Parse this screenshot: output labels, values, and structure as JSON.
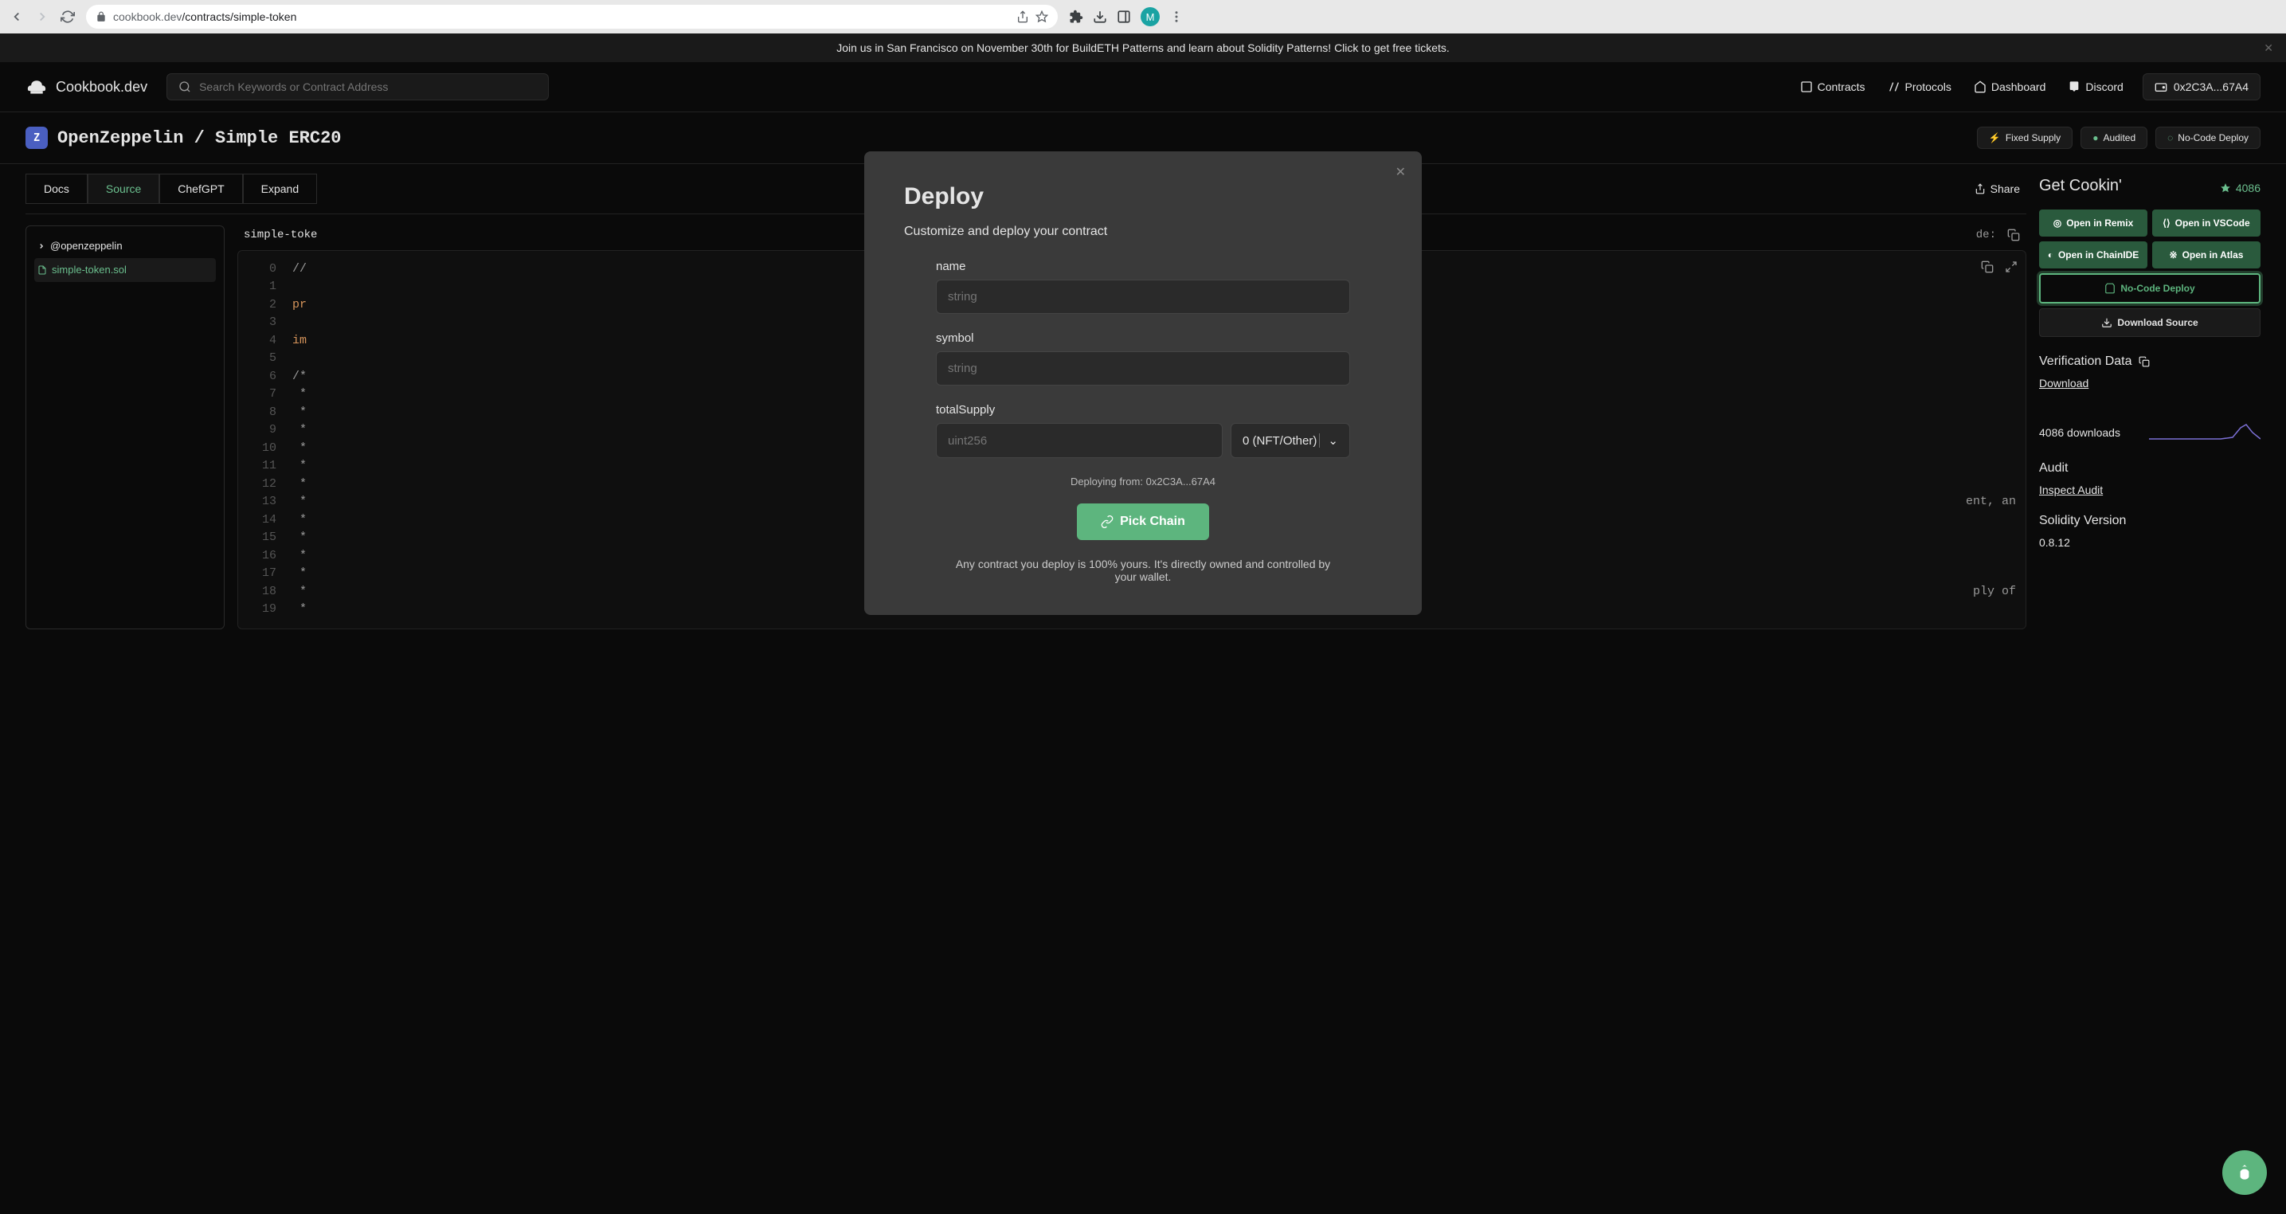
{
  "browser": {
    "url_domain": "cookbook.dev",
    "url_path": "/contracts/simple-token",
    "avatar": "M"
  },
  "banner": {
    "text": "Join us in San Francisco on November 30th for BuildETH Patterns and learn about Solidity Patterns! Click to get free tickets."
  },
  "brand": "Cookbook.dev",
  "search_placeholder": "Search Keywords or Contract Address",
  "nav": {
    "contracts": "Contracts",
    "protocols": "Protocols",
    "dashboard": "Dashboard",
    "discord": "Discord",
    "wallet": "0x2C3A...67A4"
  },
  "breadcrumb": {
    "icon_letter": "Z",
    "org": "OpenZeppelin",
    "sep": "/",
    "name": "Simple ERC20"
  },
  "badges": {
    "fixed_supply": "Fixed Supply",
    "audited": "Audited",
    "nocode": "No-Code Deploy"
  },
  "tabs": {
    "docs": "Docs",
    "source": "Source",
    "chefgpt": "ChefGPT",
    "expand": "Expand",
    "share": "Share"
  },
  "tree": {
    "folder": "@openzeppelin",
    "file": "simple-token.sol"
  },
  "code": {
    "filename": "simple-toke",
    "label_frag": "de:",
    "lines": [
      {
        "n": "0",
        "t": "//"
      },
      {
        "n": "1",
        "t": ""
      },
      {
        "n": "2",
        "t": "pr",
        "kw": true
      },
      {
        "n": "3",
        "t": ""
      },
      {
        "n": "4",
        "t": "im",
        "kw": true
      },
      {
        "n": "5",
        "t": ""
      },
      {
        "n": "6",
        "t": "/*"
      },
      {
        "n": "7",
        "t": " *"
      },
      {
        "n": "8",
        "t": " *"
      },
      {
        "n": "9",
        "t": " *"
      },
      {
        "n": "10",
        "t": " *"
      },
      {
        "n": "11",
        "t": " *"
      },
      {
        "n": "12",
        "t": " *"
      },
      {
        "n": "13",
        "t": " *",
        "tail": "ent, an"
      },
      {
        "n": "14",
        "t": " *"
      },
      {
        "n": "15",
        "t": " *"
      },
      {
        "n": "16",
        "t": " *"
      },
      {
        "n": "17",
        "t": " *"
      },
      {
        "n": "18",
        "t": " *",
        "tail": "ply of"
      },
      {
        "n": "19",
        "t": " *"
      }
    ]
  },
  "sidebar": {
    "get_cookin": "Get Cookin'",
    "stars": "4086",
    "open_remix": "Open in Remix",
    "open_vscode": "Open in VSCode",
    "open_chainide": "Open in ChainIDE",
    "open_atlas": "Open in Atlas",
    "nocode_deploy": "No-Code Deploy",
    "download_source": "Download Source",
    "verification_data": "Verification Data",
    "download": "Download",
    "downloads_text": "4086 downloads",
    "audit": "Audit",
    "inspect_audit": "Inspect Audit",
    "solidity_version": "Solidity Version",
    "solidity_value": "0.8.12"
  },
  "modal": {
    "title": "Deploy",
    "subtitle": "Customize and deploy your contract",
    "name_label": "name",
    "name_placeholder": "string",
    "symbol_label": "symbol",
    "symbol_placeholder": "string",
    "supply_label": "totalSupply",
    "supply_placeholder": "uint256",
    "decimals_option": "0 (NFT/Other)",
    "deploying_from": "Deploying from: 0x2C3A...67A4",
    "pick_chain": "Pick Chain",
    "disclaimer": "Any contract you deploy is 100% yours. It's directly owned and controlled by your wallet."
  }
}
